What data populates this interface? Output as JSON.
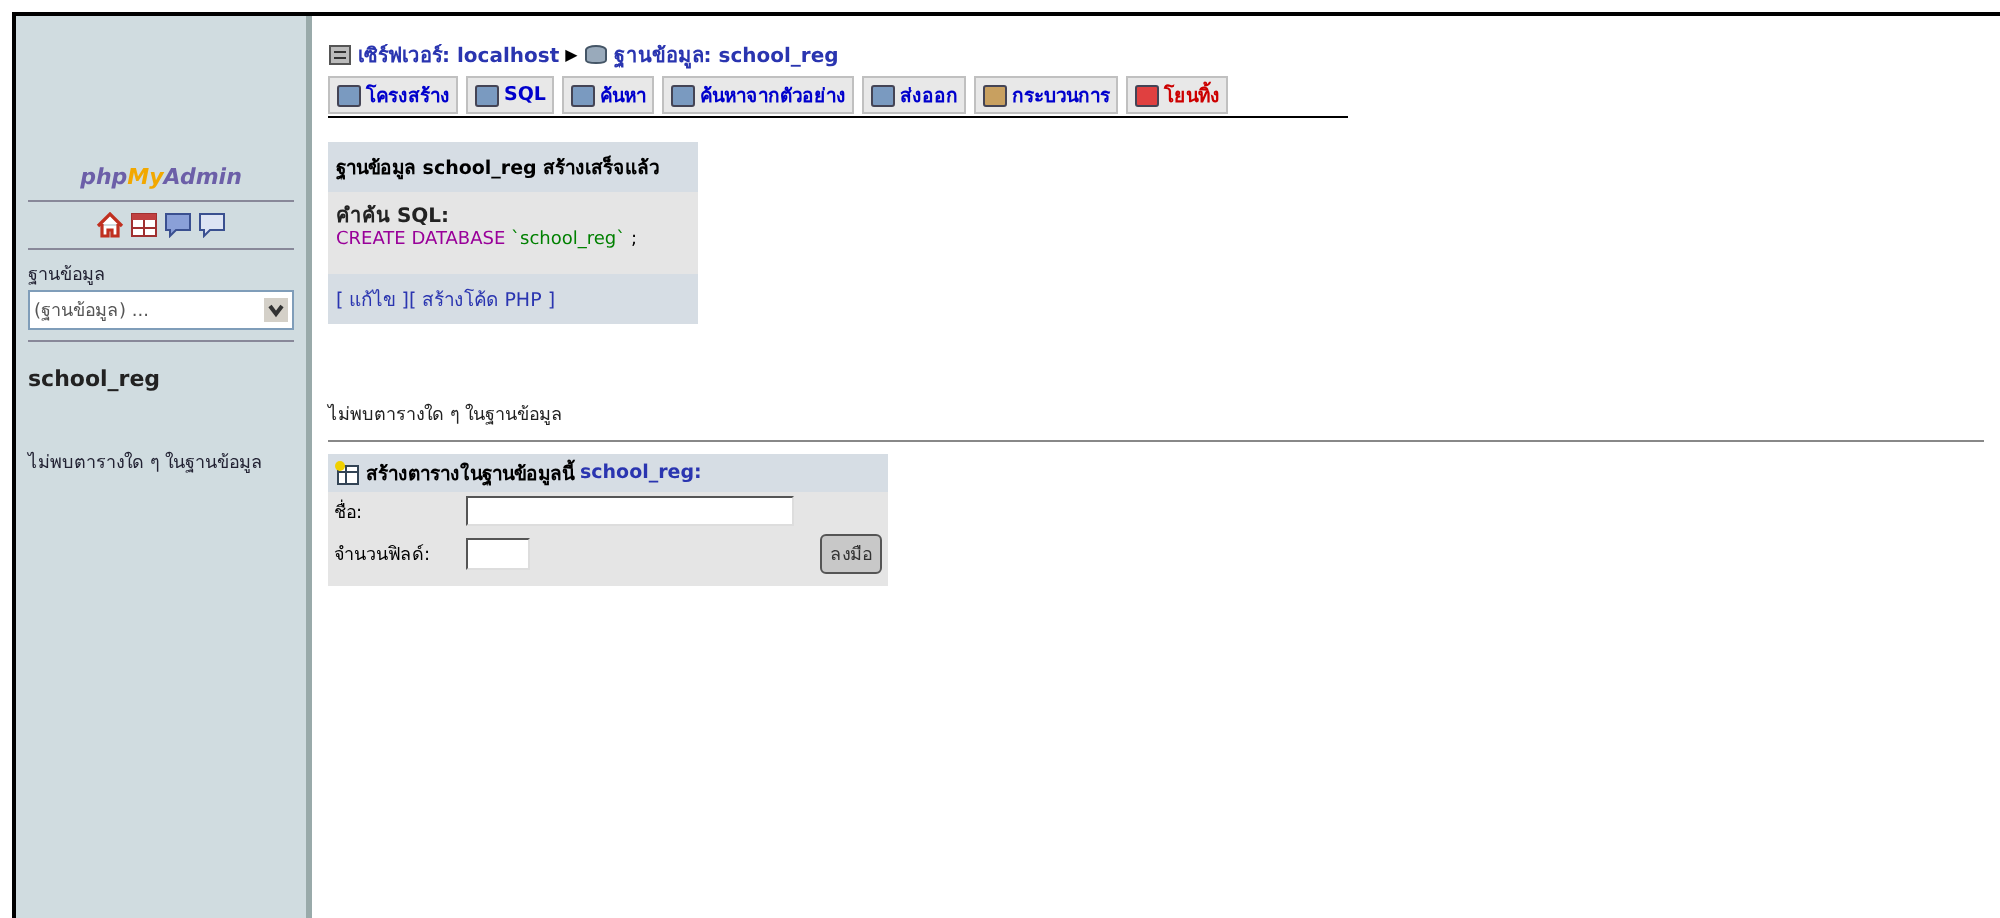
{
  "sidebar": {
    "logo": {
      "php": "php",
      "my": "My",
      "admin": "Admin"
    },
    "db_label": "ฐานข้อมูล",
    "db_select": "(ฐานข้อมูล) ...",
    "current_db": "school_reg",
    "no_tables": "ไม่พบตารางใด ๆ ในฐานข้อมูล"
  },
  "breadcrumb": {
    "server": "เซิร์ฟเวอร์: localhost",
    "sep": "▶",
    "database": "ฐานข้อมูล: school_reg"
  },
  "tabs": [
    {
      "label": "โครงสร้าง",
      "kind": "structure",
      "selected": false
    },
    {
      "label": "SQL",
      "kind": "sql",
      "selected": false
    },
    {
      "label": "ค้นหา",
      "kind": "search",
      "selected": false
    },
    {
      "label": "ค้นหาจากตัวอย่าง",
      "kind": "query",
      "selected": false
    },
    {
      "label": "ส่งออก",
      "kind": "export",
      "selected": false
    },
    {
      "label": "กระบวนการ",
      "kind": "operations",
      "selected": false
    },
    {
      "label": "โยนทิ้ง",
      "kind": "drop",
      "selected": false
    }
  ],
  "message": {
    "title": "ฐานข้อมูล school_reg สร้างเสร็จแล้ว",
    "sql_label": "คำค้น SQL:",
    "sql_keyword": "CREATE DATABASE",
    "sql_name": "`school_reg`",
    "sql_end": ";",
    "links": [
      {
        "label": "[ แก้ไข ]"
      },
      {
        "label": "[ สร้างโค้ด PHP ]"
      }
    ]
  },
  "no_tables": "ไม่พบตารางใด ๆ ในฐานข้อมูล",
  "create_table": {
    "title": "สร้างตารางในฐานข้อมูลนี้",
    "db": "school_reg:",
    "name_label": "ชื่อ:",
    "fields_label": "จำนวนฟิลด์:",
    "button": "ลงมือ"
  }
}
